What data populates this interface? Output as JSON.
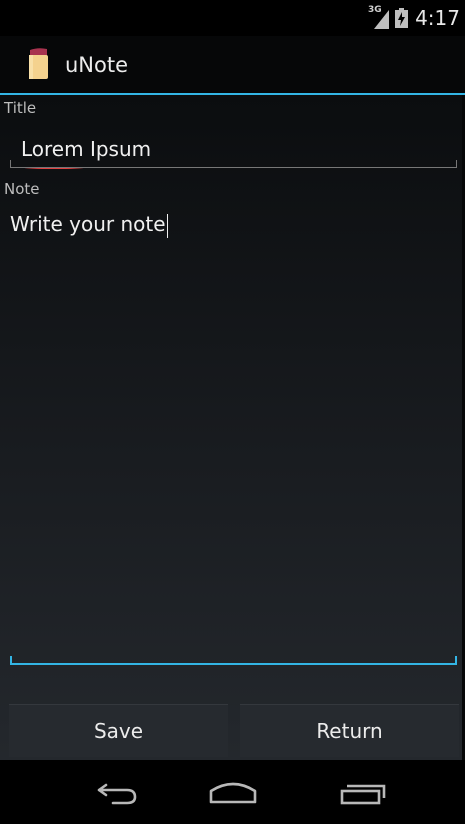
{
  "status_bar": {
    "network": "3G",
    "time": "4:17"
  },
  "action_bar": {
    "app_title": "uNote",
    "icon": "note-app-icon"
  },
  "form": {
    "title_label": "Title",
    "title_value": "Lorem Ipsum",
    "note_label": "Note",
    "note_value": "Write your note"
  },
  "buttons": {
    "save_label": "Save",
    "return_label": "Return"
  },
  "nav_bar": {
    "back_icon": "back-icon",
    "home_icon": "home-icon",
    "recent_icon": "recent-apps-icon"
  },
  "colors": {
    "accent": "#33b5e5",
    "spellcheck": "#e04040",
    "button_bg": "#262a2f"
  }
}
